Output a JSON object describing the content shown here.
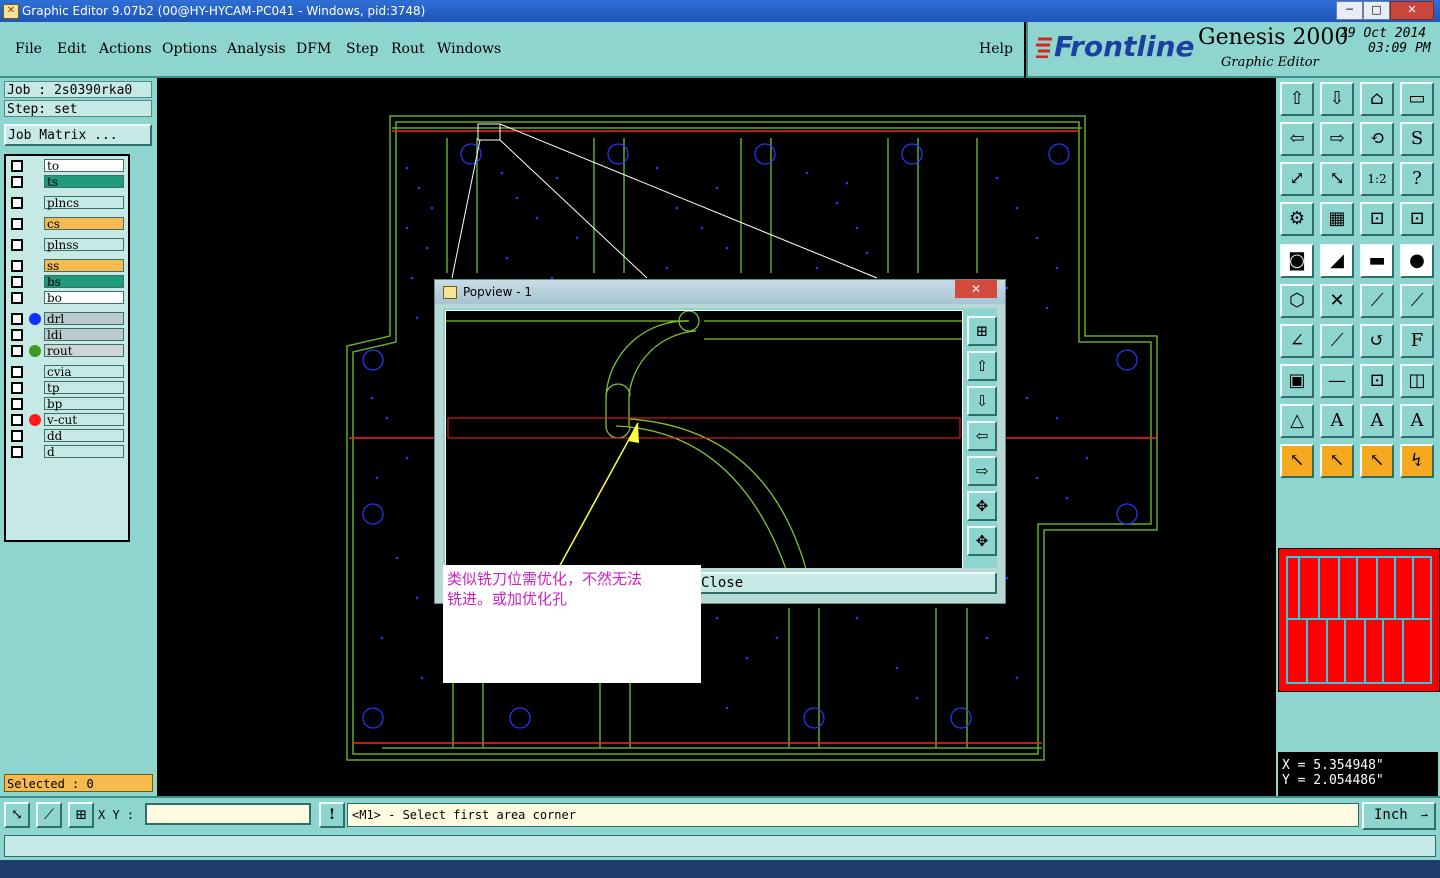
{
  "window": {
    "title": "Graphic Editor 9.07b2 (00@HY-HYCAM-PC041 - Windows, pid:3748)",
    "minimize": "─",
    "maximize": "□",
    "close": "✕"
  },
  "menu": {
    "file": "File",
    "edit": "Edit",
    "actions": "Actions",
    "options": "Options",
    "analysis": "Analysis",
    "dfm": "DFM",
    "step": "Step",
    "rout": "Rout",
    "windows": "Windows",
    "help": "Help"
  },
  "brand": {
    "logo": "Frontline",
    "product": "Genesis 2000",
    "subtitle": "Graphic Editor",
    "date": "29 Oct 2014",
    "time": "03:09 PM"
  },
  "job": {
    "job_line": "Job : 2s0390rka0",
    "step_line": "Step: set",
    "matrix_button": "Job Matrix ..."
  },
  "layers": [
    {
      "name": "to",
      "color": "#ffffff",
      "dot": ""
    },
    {
      "name": "ts",
      "color": "#1f9a7a",
      "dot": ""
    },
    {
      "name": "plncs",
      "color": "#c7e9e6",
      "dot": ""
    },
    {
      "name": "cs",
      "color": "#f6ba4f",
      "dot": ""
    },
    {
      "name": "plnss",
      "color": "#c7e9e6",
      "dot": ""
    },
    {
      "name": "ss",
      "color": "#f6ba4f",
      "dot": ""
    },
    {
      "name": "bs",
      "color": "#1f9a7a",
      "dot": ""
    },
    {
      "name": "bo",
      "color": "#ffffff",
      "dot": ""
    },
    {
      "name": "drl",
      "color": "#b9c9cc",
      "dot": "#1030ff"
    },
    {
      "name": "ldi",
      "color": "#b9c9cc",
      "dot": ""
    },
    {
      "name": "rout",
      "color": "#d0d6d6",
      "dot": "#3a9a20"
    },
    {
      "name": "cvia",
      "color": "#c7e9e6",
      "dot": ""
    },
    {
      "name": "tp",
      "color": "#c7e9e6",
      "dot": ""
    },
    {
      "name": "bp",
      "color": "#c7e9e6",
      "dot": ""
    },
    {
      "name": "v-cut",
      "color": "#c7e9e6",
      "dot": "#ff1a1a"
    },
    {
      "name": "dd",
      "color": "#c7e9e6",
      "dot": ""
    },
    {
      "name": "d",
      "color": "#c7e9e6",
      "dot": ""
    }
  ],
  "selected": "Selected : 0",
  "popview": {
    "title": "Popview - 1",
    "close_button": "Close",
    "close_x": "✕"
  },
  "annotation": {
    "line1": "类似铣刀位需优化，不然无法",
    "line2": "铣进。或加优化孔"
  },
  "coords": {
    "x": "X  = 5.354948\"",
    "y": "Y  = 2.054486\""
  },
  "bottom": {
    "xy_label": "X Y :",
    "xy_value": "",
    "prompt": "<M1> - Select first area corner",
    "units": "Inch"
  },
  "tools": [
    {
      "icon": "zoom-home-icon"
    },
    {
      "icon": "zoom-step-icon"
    },
    {
      "icon": "home-icon"
    },
    {
      "icon": "window-icon"
    },
    {
      "icon": "pan-left-icon"
    },
    {
      "icon": "pan-right-icon"
    },
    {
      "icon": "zoom-fit-icon"
    },
    {
      "icon": "redraw-icon"
    },
    {
      "icon": "zoom-in-icon"
    },
    {
      "icon": "zoom-out-icon"
    },
    {
      "icon": "scale-icon"
    },
    {
      "icon": "help-icon"
    },
    {
      "icon": "measure-icon"
    },
    {
      "icon": "grid-icon"
    },
    {
      "icon": "snap-icon"
    },
    {
      "icon": "snap-red-icon"
    },
    {
      "icon": "pad-icon"
    },
    {
      "icon": "select-icon"
    },
    {
      "icon": "ruler-icon"
    },
    {
      "icon": "circle-icon"
    },
    {
      "icon": "connect-icon"
    },
    {
      "icon": "cross-icon"
    },
    {
      "icon": "line-icon"
    },
    {
      "icon": "line-red-icon"
    },
    {
      "icon": "angle-icon"
    },
    {
      "icon": "slope-icon"
    },
    {
      "icon": "arc-icon"
    },
    {
      "icon": "ff-icon"
    },
    {
      "icon": "box-icon"
    },
    {
      "icon": "split-icon"
    },
    {
      "icon": "dim-icon"
    },
    {
      "icon": "group-icon"
    },
    {
      "icon": "triangle-icon"
    },
    {
      "icon": "a-icon"
    },
    {
      "icon": "a-bold-icon"
    },
    {
      "icon": "a-red-icon"
    },
    {
      "icon": "pointer-icon"
    },
    {
      "icon": "pointer-box-icon"
    },
    {
      "icon": "pointer-circle-icon"
    },
    {
      "icon": "pointer-path-icon"
    }
  ],
  "pv_tools": [
    {
      "icon": "pv-zoom-icon"
    },
    {
      "icon": "pv-up-icon"
    },
    {
      "icon": "pv-down-icon"
    },
    {
      "icon": "pv-left-icon"
    },
    {
      "icon": "pv-right-icon"
    },
    {
      "icon": "pv-fit-icon"
    },
    {
      "icon": "pv-center-icon"
    }
  ]
}
